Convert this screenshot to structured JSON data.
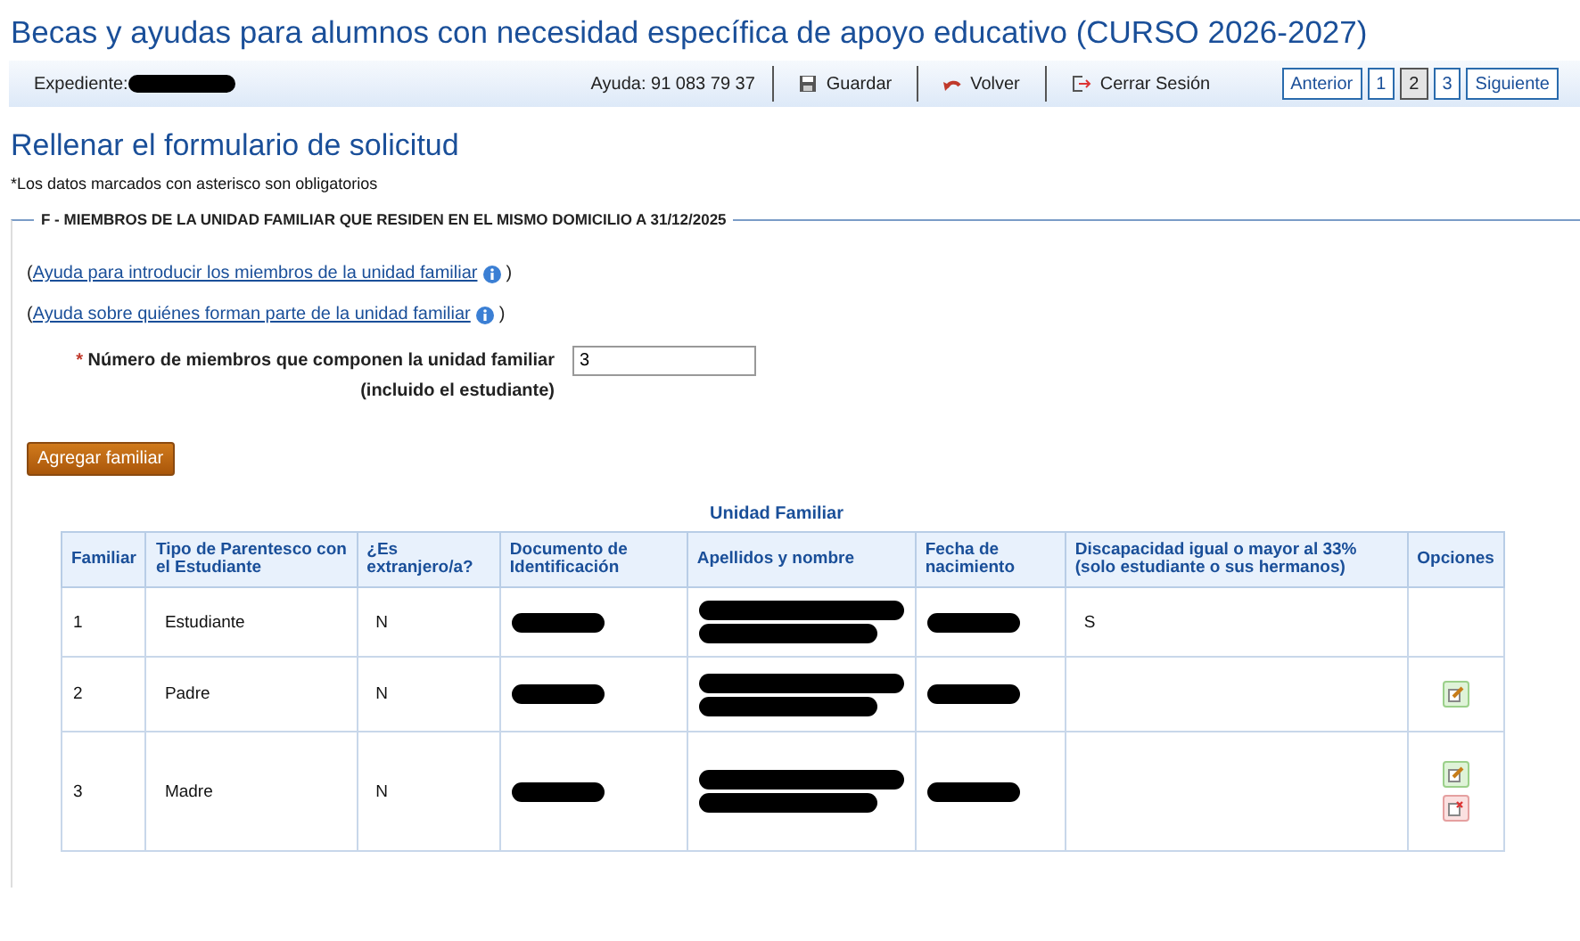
{
  "page_title": "Becas y ayudas para alumnos con necesidad específica de apoyo educativo (CURSO 2026-2027)",
  "toolbar": {
    "expediente_label": "Expediente:",
    "expediente_redacted": true,
    "help_phone": "Ayuda: 91 083 79 37",
    "actions": [
      {
        "kind": "save",
        "label": "Guardar"
      },
      {
        "kind": "back",
        "label": "Volver"
      },
      {
        "kind": "logout",
        "label": "Cerrar Sesión"
      }
    ],
    "pagination": {
      "previous": "Anterior",
      "pages": [
        {
          "label": "1",
          "selected": false
        },
        {
          "label": "2",
          "selected": true
        },
        {
          "label": "3",
          "selected": false
        }
      ],
      "next": "Siguiente"
    }
  },
  "form_title": "Rellenar el formulario de solicitud",
  "required_note": "*Los datos marcados con asterisco son obligatorios",
  "section": {
    "legend": "F - MIEMBROS DE LA UNIDAD FAMILIAR QUE RESIDEN EN EL MISMO DOMICILIO A 31/12/2025",
    "help_links": [
      {
        "open": "(",
        "label": "Ayuda para introducir los miembros de la unidad familiar",
        "close": ")"
      },
      {
        "open": "(",
        "label": "Ayuda sobre quiénes forman parte de la unidad familiar",
        "close": ")"
      }
    ],
    "members_field": {
      "required_mark": "*",
      "label": "Número de miembros que componen la unidad familiar (incluido el estudiante)",
      "value": "3"
    },
    "add_button": "Agregar familiar",
    "table": {
      "caption": "Unidad Familiar",
      "columns": [
        "Familiar",
        "Tipo de Parentesco con el Estudiante",
        "¿Es extranjero/a?",
        "Documento de Identificación",
        "Apellidos y nombre",
        "Fecha de nacimiento",
        "Discapacidad igual o mayor al 33% (solo estudiante o sus hermanos)",
        "Opciones"
      ],
      "rows": [
        {
          "familiar": "1",
          "relationship": "Estudiante",
          "foreign": "N",
          "document_redacted": true,
          "name_redacted": true,
          "birth_date_redacted": true,
          "disability": "S"
        },
        {
          "familiar": "2",
          "relationship": "Padre",
          "foreign": "N",
          "document_redacted": true,
          "name_redacted": true,
          "birth_date_redacted": true,
          "options": [
            {
              "kind": "edit"
            }
          ]
        },
        {
          "familiar": "3",
          "relationship": "Madre",
          "foreign": "N",
          "document_redacted": true,
          "name_redacted": true,
          "birth_date_redacted": true,
          "options": [
            {
              "kind": "edit"
            },
            {
              "kind": "delete"
            }
          ]
        }
      ]
    }
  }
}
